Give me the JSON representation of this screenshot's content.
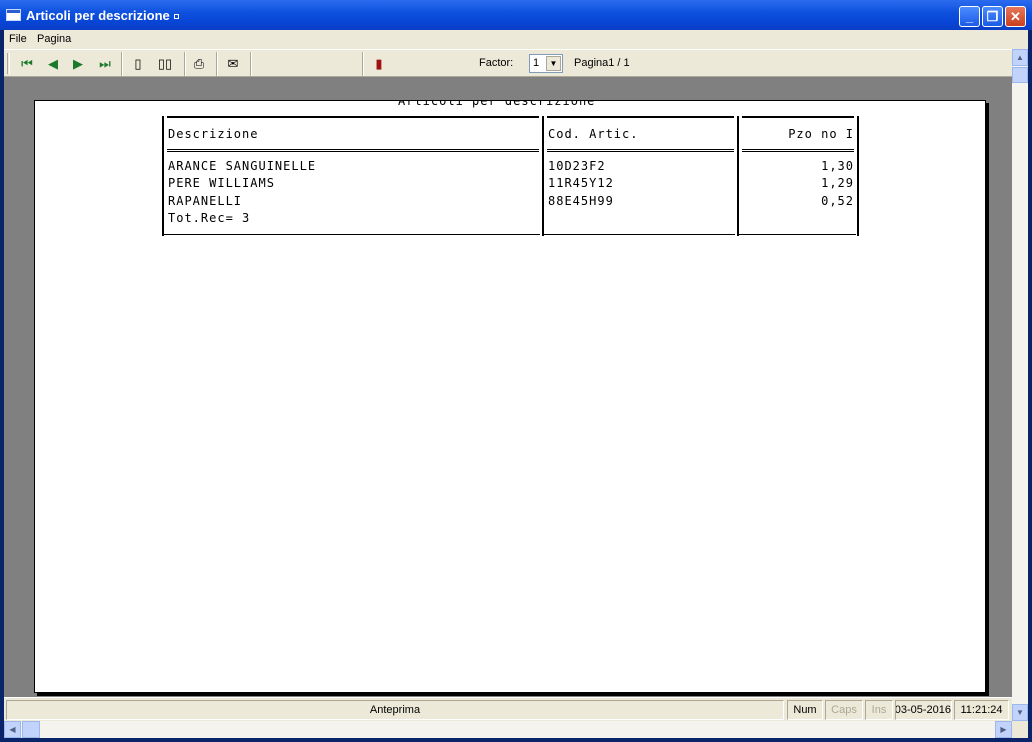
{
  "window": {
    "title": "Articoli per descrizione",
    "minimize_icon": "minimize-icon",
    "maximize_icon": "restore-icon",
    "close_icon": "close-icon"
  },
  "menu": {
    "items": [
      "File",
      "Pagina"
    ]
  },
  "toolbar": {
    "icons": [
      "first-page-icon",
      "prev-page-icon",
      "next-page-icon",
      "last-page-icon",
      "single-page-icon",
      "two-pages-icon",
      "print-icon",
      "export-icon",
      "exit-icon"
    ],
    "factor_label": "Factor:",
    "factor_value": "1",
    "page_info": "Pagina1 / 1"
  },
  "report": {
    "title": "Articoli per descrizione",
    "columns": [
      "Descrizione",
      "Cod. Artic.",
      "Pzo no I"
    ],
    "rows": [
      {
        "descrizione": "ARANCE SANGUINELLE",
        "codice": "10D23F2",
        "prezzo": "1,30"
      },
      {
        "descrizione": "PERE WILLIAMS",
        "codice": "11R45Y12",
        "prezzo": "1,29"
      },
      {
        "descrizione": "RAPANELLI",
        "codice": "88E45H99",
        "prezzo": "0,52"
      }
    ],
    "total": "Tot.Rec= 3"
  },
  "statusbar": {
    "mode": "Anteprima",
    "num": "Num",
    "caps": "Caps",
    "ins": "Ins",
    "date": "03-05-2016",
    "time": "11:21:24"
  },
  "colors": {
    "titlebar": "#0a3ec4",
    "chrome": "#ece9d8",
    "canvas": "#808080"
  }
}
